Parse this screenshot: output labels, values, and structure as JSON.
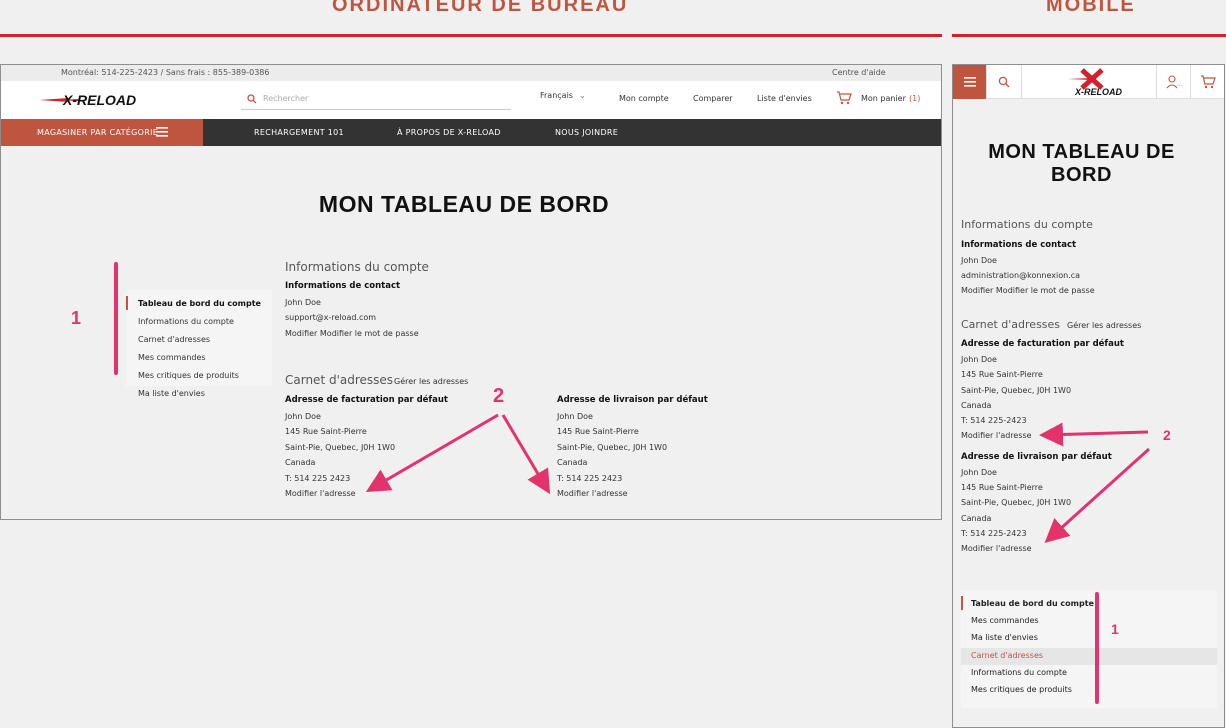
{
  "sections": {
    "desktop_title": "ORDINATEUR DE BUREAU",
    "mobile_title": "MOBILE"
  },
  "desktop": {
    "topbar": {
      "phones": "Montréal: 514-225-2423 / Sans frais : 855-389-0386",
      "help": "Centre d'aide"
    },
    "logo": "X-RELOAD",
    "search_placeholder": "Rechercher",
    "header_links": {
      "language": "Français",
      "account": "Mon compte",
      "compare": "Comparer",
      "wishlist": "Liste d'envies",
      "cart": "Mon panier",
      "cart_count": "(1)"
    },
    "nav": {
      "shop_by_category": "MAGASINER PAR CATÉGORIE",
      "items": [
        "RECHARGEMENT 101",
        "À PROPOS DE X-RELOAD",
        "NOUS JOINDRE"
      ]
    },
    "page_title": "MON TABLEAU DE BORD",
    "sidebar": [
      "Tableau de bord du compte",
      "Informations du compte",
      "Carnet d'adresses",
      "Mes commandes",
      "Mes critiques de produits",
      "Ma liste d'envies"
    ],
    "account_info": {
      "title": "Informations du compte",
      "contact_title": "Informations de contact",
      "name": "John Doe",
      "email": "support@x-reload.com",
      "actions": "Modifier Modifier le mot de passe"
    },
    "address_book": {
      "title": "Carnet d'adresses",
      "manage": "Gérer les adresses",
      "billing": {
        "title": "Adresse de facturation par défaut",
        "lines": [
          "John Doe",
          "145 Rue Saint-Pierre",
          "Saint-Pie, Quebec, J0H 1W0",
          "Canada",
          "T: 514 225 2423"
        ],
        "edit": "Modifier l'adresse"
      },
      "shipping": {
        "title": "Adresse de livraison par défaut",
        "lines": [
          "John Doe",
          "145 Rue Saint-Pierre",
          "Saint-Pie, Quebec, J0H 1W0",
          "Canada",
          "T: 514 225 2423"
        ],
        "edit": "Modifier l'adresse"
      }
    },
    "annotations": {
      "one": "1",
      "two": "2"
    }
  },
  "mobile": {
    "logo": "X-RELOAD",
    "page_title_line1": "MON TABLEAU DE",
    "page_title_line2": "BORD",
    "account_info": {
      "title": "Informations du compte",
      "contact_title": "Informations de contact",
      "name": "John Doe",
      "email": "administration@konnexion.ca",
      "actions": "Modifier Modifier le mot de passe"
    },
    "address_book": {
      "title": "Carnet d'adresses",
      "manage": "Gérer les adresses",
      "billing": {
        "title": "Adresse de facturation par défaut",
        "lines": [
          "John Doe",
          "145 Rue Saint-Pierre",
          "Saint-Pie, Quebec, J0H 1W0",
          "Canada",
          "T: 514 225-2423"
        ],
        "edit": "Modifier l'adresse"
      },
      "shipping": {
        "title": "Adresse de livraison par défaut",
        "lines": [
          "John Doe",
          "145 Rue Saint-Pierre",
          "Saint-Pie, Quebec, J0H 1W0",
          "Canada",
          "T: 514 225-2423"
        ],
        "edit": "Modifier l'adresse"
      }
    },
    "menu": [
      "Tableau de bord du compte",
      "Mes commandes",
      "Ma liste d'envies",
      "Carnet d'adresses",
      "Informations du compte",
      "Mes critiques de produits"
    ],
    "annotations": {
      "one": "1",
      "two": "2"
    }
  },
  "colors": {
    "accent": "#c0553f",
    "red_line": "#d3202a",
    "annotation": "#e2336b",
    "nav_dark": "#333333"
  }
}
